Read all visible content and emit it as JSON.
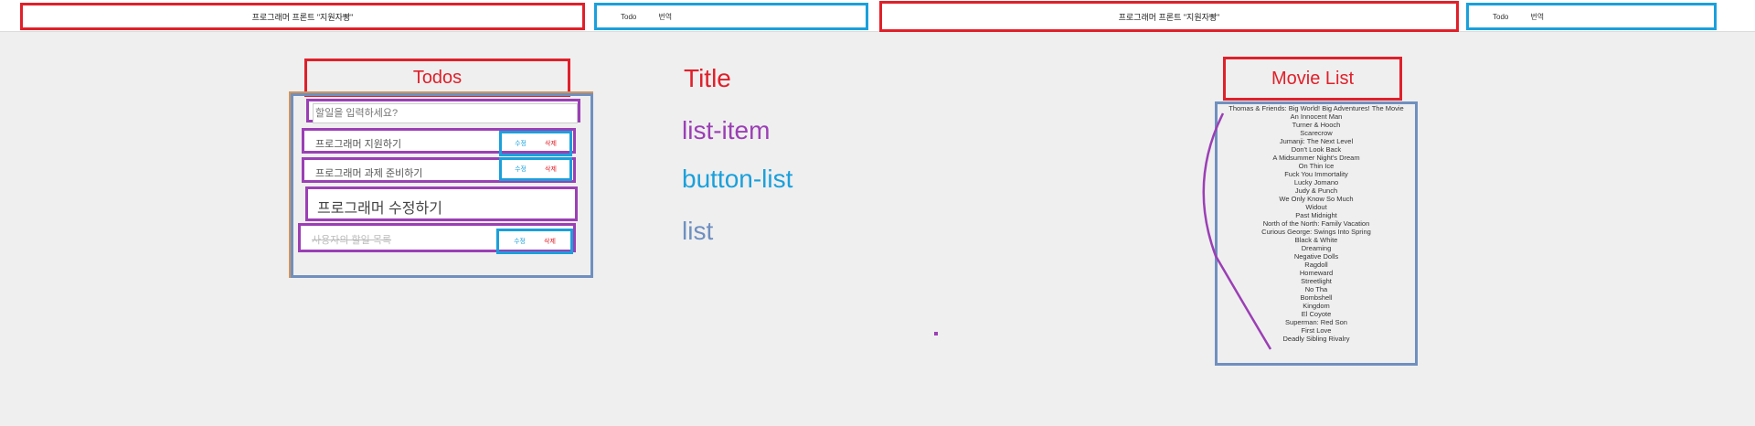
{
  "header": {
    "left_title": "프로그래머 프론트 \"지원자빵\"",
    "right_title": "프로그래머 프론트 \"지원자빵\"",
    "nav_left": [
      "Todo",
      "번역"
    ],
    "nav_right": [
      "Todo",
      "번역"
    ]
  },
  "todos": {
    "title": "Todos",
    "input_placeholder": "할일을 입력하세요?",
    "items": [
      {
        "text": "프로그래머 지원하기",
        "buttons": [
          "수정",
          "삭제"
        ]
      },
      {
        "text": "프로그래머 과제 준비하기",
        "buttons": [
          "수정",
          "삭제"
        ]
      },
      {
        "text": "프로그래머 수정하기",
        "buttons": []
      },
      {
        "text": "사용자의 할일 목록",
        "buttons": [
          "수정",
          "삭제"
        ]
      }
    ]
  },
  "legend": {
    "title": "Title",
    "list_item": "list-item",
    "button_list": "button-list",
    "list": "list"
  },
  "movies": {
    "title": "Movie List",
    "items": [
      "Thomas & Friends: Big World! Big Adventures! The Movie",
      "An Innocent Man",
      "Turner & Hooch",
      "Scarecrow",
      "Jumanji: The Next Level",
      "Don't Look Back",
      "A Midsummer Night's Dream",
      "On Thin Ice",
      "Fuck You Immortality",
      "Lucky Jomano",
      "Judy & Punch",
      "We Only Know So Much",
      "Widout",
      "Past Midnight",
      "North of the North: Family Vacation",
      "Curious George: Swings Into Spring",
      "Black & White",
      "Dreaming",
      "Negative Dolls",
      "Ragdoll",
      "Homeward",
      "Streetlight",
      "No Tha",
      "Bombshell",
      "Kingdom",
      "El Coyote",
      "Superman: Red Son",
      "First Love",
      "Deadly Sibling Rivalry"
    ]
  },
  "colors": {
    "title": "#e0202a",
    "list_item": "#9b3fb5",
    "button_list": "#1aa0db",
    "list": "#6f8fbf"
  }
}
